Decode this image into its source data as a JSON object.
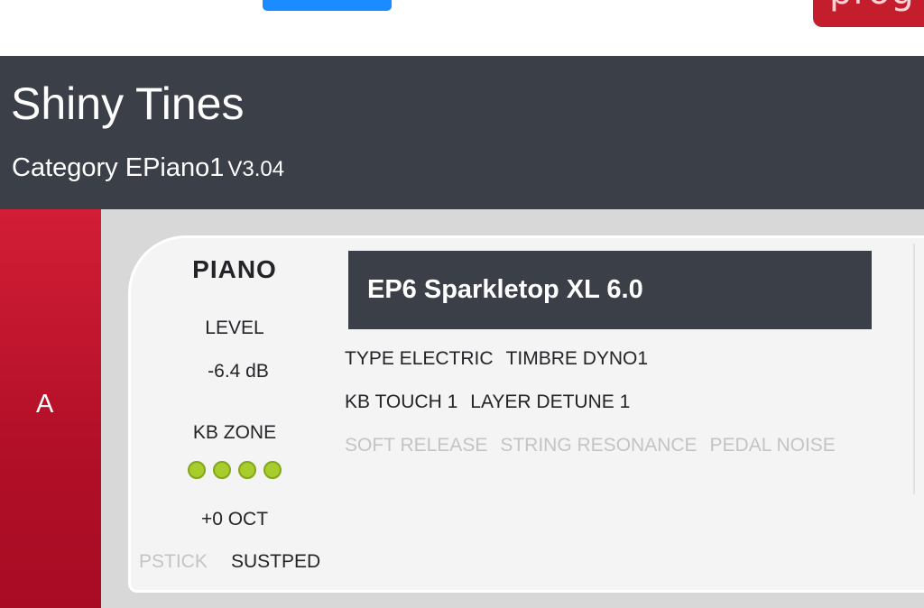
{
  "topbar": {
    "logo_text": "prog",
    "colors": {
      "button": "#1a8cff",
      "logo": "#c41e2d"
    }
  },
  "header": {
    "title": "Shiny Tines",
    "subtitle": "Category EPiano1",
    "version": "V3.04"
  },
  "slot": {
    "letter": "A"
  },
  "piano": {
    "section_name": "PIANO",
    "level_label": "LEVEL",
    "level_value": "-6.4 dB",
    "kb_zone_label": "KB ZONE",
    "kb_zones_active": 4,
    "octave_value": "+0 OCT",
    "pstick_label": "PSTICK",
    "sustped_label": "SUSTPED",
    "model": "EP6 Sparkletop XL 6.0",
    "params": {
      "type": "TYPE ELECTRIC",
      "timbre": "TIMBRE DYNO1",
      "kb_touch": "KB TOUCH 1",
      "layer_detune": "LAYER DETUNE 1",
      "soft_release": "SOFT RELEASE",
      "string_resonance": "STRING RESONANCE",
      "pedal_noise": "PEDAL NOISE"
    }
  },
  "colors": {
    "header_bg": "#3b3f47",
    "slot_red": "#b20f28",
    "zone_led": "#a6cd2c",
    "disabled_text": "#c4c4c4"
  }
}
